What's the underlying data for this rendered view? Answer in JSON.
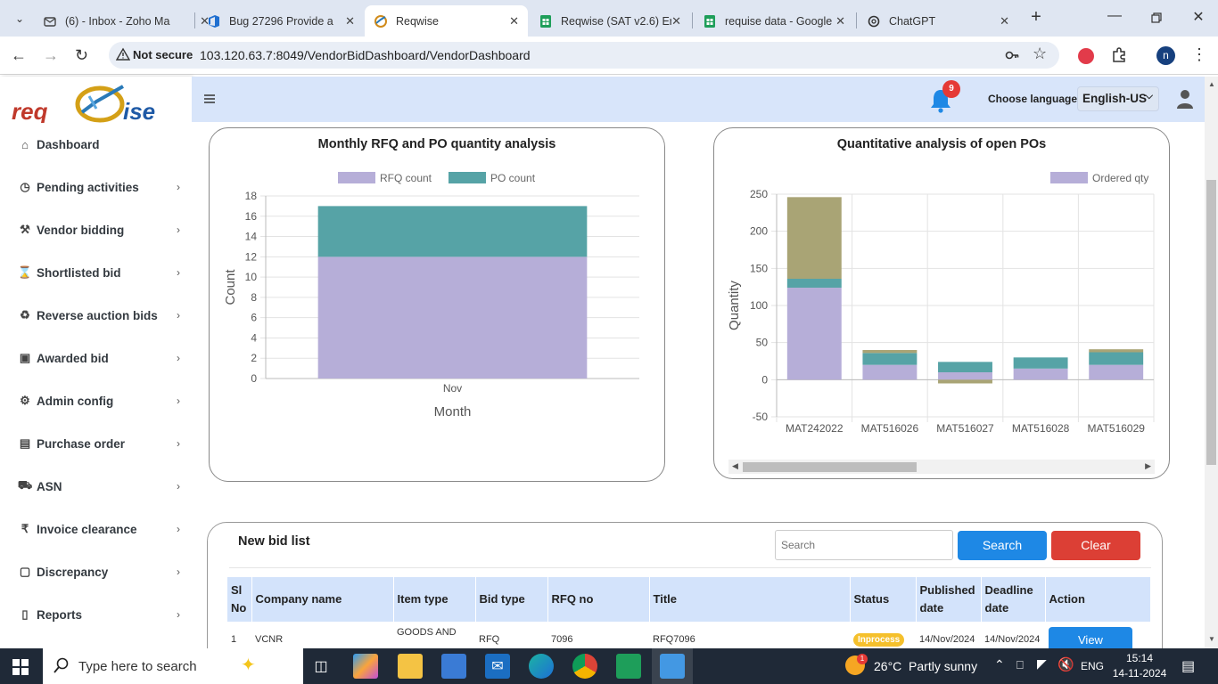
{
  "browser": {
    "tabs": [
      {
        "title": "(6) - Inbox - Zoho Ma",
        "icon": "mail-icon"
      },
      {
        "title": "Bug 27296 Provide a",
        "icon": "azure-devops-icon"
      },
      {
        "title": "Reqwise",
        "icon": "reqwise-icon"
      },
      {
        "title": "Reqwise (SAT v2.6) Er",
        "icon": "sheets-icon"
      },
      {
        "title": "requise data - Google",
        "icon": "sheets-icon"
      },
      {
        "title": "ChatGPT",
        "icon": "chatgpt-icon"
      }
    ],
    "security_label": "Not secure",
    "url": "103.120.63.7:8049/VendorBidDashboard/VendorDashboard",
    "profile_initial": "n"
  },
  "app": {
    "logo_text": "REQWISE",
    "notification_count": "9",
    "choose_language_label": "Choose language",
    "language_value": "English-US"
  },
  "sidebar": {
    "items": [
      {
        "label": "Dashboard",
        "icon": "home-icon",
        "chevron": false
      },
      {
        "label": "Pending activities",
        "icon": "clock-icon",
        "chevron": true
      },
      {
        "label": "Vendor bidding",
        "icon": "gavel-icon",
        "chevron": true
      },
      {
        "label": "Shortlisted bid",
        "icon": "hourglass-icon",
        "chevron": true
      },
      {
        "label": "Reverse auction bids",
        "icon": "recycle-icon",
        "chevron": true
      },
      {
        "label": "Awarded bid",
        "icon": "briefcase-icon",
        "chevron": true
      },
      {
        "label": "Admin config",
        "icon": "gear-icon",
        "chevron": true
      },
      {
        "label": "Purchase order",
        "icon": "document-icon",
        "chevron": true
      },
      {
        "label": "ASN",
        "icon": "truck-icon",
        "chevron": true
      },
      {
        "label": "Invoice clearance",
        "icon": "rupee-icon",
        "chevron": true
      },
      {
        "label": "Discrepancy",
        "icon": "window-icon",
        "chevron": true
      },
      {
        "label": "Reports",
        "icon": "book-icon",
        "chevron": true
      }
    ]
  },
  "chart_data": [
    {
      "type": "bar",
      "stacked": true,
      "title": "Monthly RFQ and PO quantity analysis",
      "categories": [
        "Nov"
      ],
      "series": [
        {
          "name": "RFQ count",
          "values": [
            12
          ],
          "color": "#b6aed8"
        },
        {
          "name": "PO count",
          "values": [
            5
          ],
          "color": "#56a3a6"
        }
      ],
      "xlabel": "Month",
      "ylabel": "Count",
      "ylim": [
        0,
        18
      ],
      "yticks": [
        "0",
        "2",
        "4",
        "6",
        "8",
        "10",
        "12",
        "14",
        "16",
        "18"
      ],
      "legend": "top"
    },
    {
      "type": "bar",
      "stacked": true,
      "title": "Quantitative analysis of open POs",
      "categories": [
        "MAT242022",
        "MAT516026",
        "MAT516027",
        "MAT516028",
        "MAT516029"
      ],
      "series": [
        {
          "name": "Ordered qty",
          "values": [
            124,
            20,
            10,
            15,
            20
          ],
          "color": "#b6aed8"
        },
        {
          "values": [
            12,
            16,
            14,
            15,
            17
          ],
          "color": "#56a3a6"
        },
        {
          "values": [
            110,
            4,
            -5,
            0,
            4
          ],
          "color": "#a9a475"
        }
      ],
      "ylabel": "Quantity",
      "ylim": [
        -50,
        250
      ],
      "yticks": [
        "-50",
        "0",
        "50",
        "100",
        "150",
        "200",
        "250"
      ],
      "legend": "top-right"
    }
  ],
  "bid_list": {
    "title": "New bid list",
    "search_placeholder": "Search",
    "search_button": "Search",
    "clear_button": "Clear",
    "headers": [
      "Sl No",
      "Company name",
      "Item type",
      "Bid type",
      "RFQ no",
      "Title",
      "Status",
      "Published date",
      "Deadline date",
      "Action"
    ],
    "rows": [
      {
        "sl": "1",
        "company": "VCNR",
        "item_type": "GOODS AND",
        "bid_type": "RFQ",
        "rfq_no": "7096",
        "title": "RFQ7096",
        "status": "Inprocess",
        "published": "14/Nov/2024",
        "deadline": "14/Nov/2024",
        "action": "View"
      }
    ]
  },
  "taskbar": {
    "search_placeholder": "Type here to search",
    "weather": "26°C  Partly sunny",
    "lang": "ENG",
    "time": "15:14",
    "date": "14-11-2024",
    "notif_count": "1"
  }
}
